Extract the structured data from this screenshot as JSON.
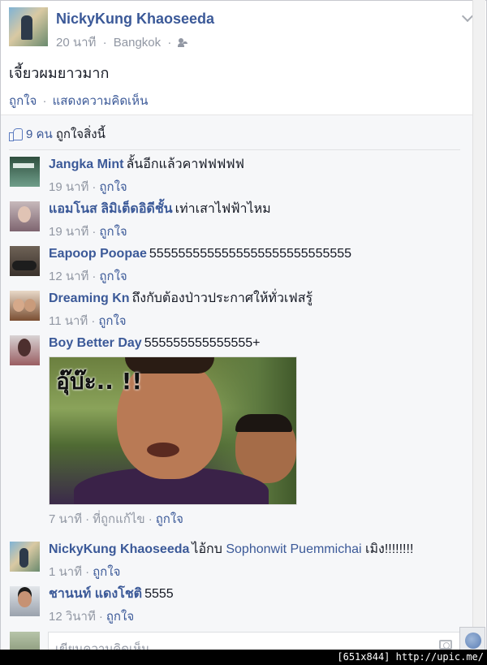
{
  "post": {
    "author": "NickyKung Khaoseeda",
    "time": "20 นาที",
    "location": "Bangkok",
    "text": "เจี้ยวผมยาวมาก",
    "like_label": "ถูกใจ",
    "comment_label": "แสดงความคิดเห็น",
    "separator": "·"
  },
  "likes": {
    "count": "9 คน",
    "text": "ถูกใจสิ่งนี้"
  },
  "comments": [
    {
      "name": "Jangka Mint",
      "text": "ลั้นอีกแล้วคาฟฟฟฟฟ",
      "time": "19 นาที",
      "like": "ถูกใจ"
    },
    {
      "name": "แอมโนส ลิมิเต็ดอิดีชั้น",
      "text": "เท่าเสาไฟฟ้าไหม",
      "time": "19 นาที",
      "like": "ถูกใจ"
    },
    {
      "name": "Eapoop Poopae",
      "text": "5555555555555555555555555555",
      "time": "12 นาที",
      "like": "ถูกใจ"
    },
    {
      "name": "Dreaming Kn",
      "text": "ถึงกับต้องป่าวประกาศให้ทั่วเฟสรู้",
      "time": "11 นาที",
      "like": "ถูกใจ"
    },
    {
      "name": "Boy Better Day",
      "text": "555555555555555+",
      "photo_caption": "อุ๊บ๊ะ.. !!",
      "time": "7 นาที",
      "edited": "ที่ถูกแก้ไข",
      "like": "ถูกใจ"
    },
    {
      "name": "NickyKung Khaoseeda",
      "text_pre": "ไอ้กบ",
      "mention": "Sophonwit Puemmichai",
      "text_post": "เมิง!!!!!!!!",
      "time": "1 นาที",
      "like": "ถูกใจ"
    },
    {
      "name": "ชานนท์ แดงโชติ",
      "text": "5555",
      "time": "12 วินาที",
      "like": "ถูกใจ"
    }
  ],
  "compose": {
    "placeholder": "เขียนความคิดเห็น..."
  },
  "footer": {
    "text": "[651x844] http://upic.me/"
  }
}
